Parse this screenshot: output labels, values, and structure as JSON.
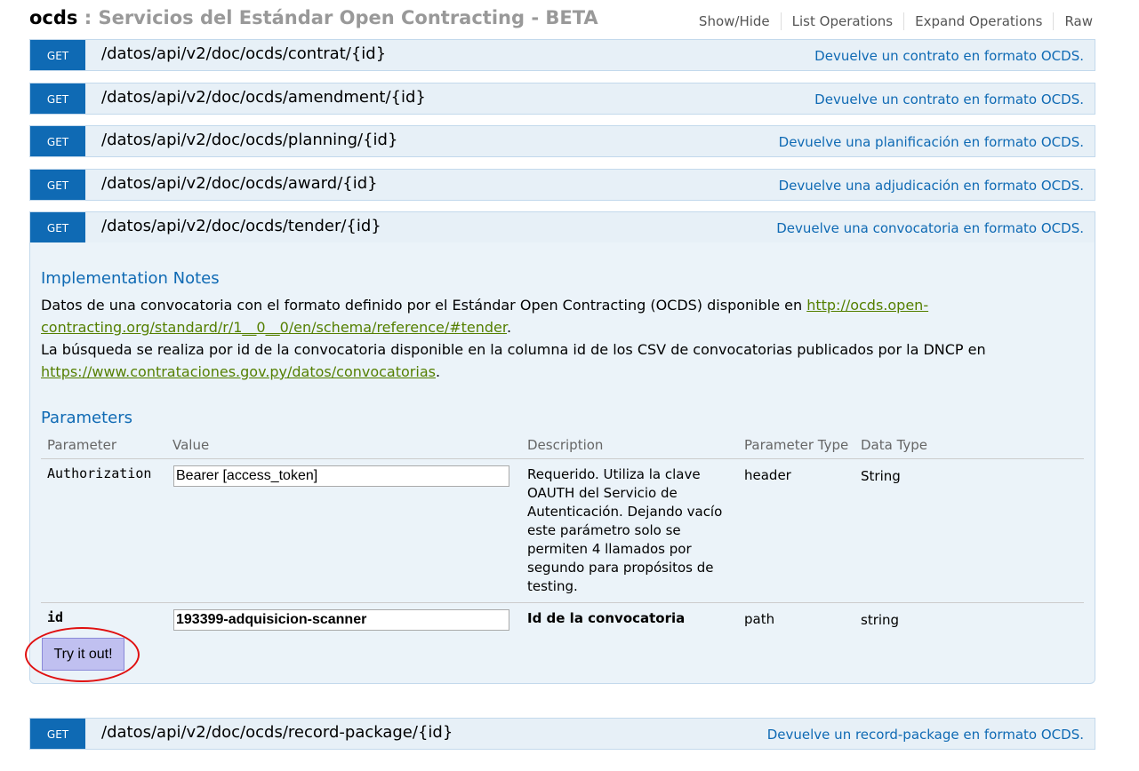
{
  "header": {
    "name": "ocds",
    "separator": " : ",
    "subtitle": "Servicios del Estándar Open Contracting - BETA",
    "links": [
      "Show/Hide",
      "List Operations",
      "Expand Operations",
      "Raw"
    ]
  },
  "operations": [
    {
      "method": "GET",
      "path": "/datos/api/v2/doc/ocds/contrat/{id}",
      "summary": "Devuelve un contrato en formato OCDS."
    },
    {
      "method": "GET",
      "path": "/datos/api/v2/doc/ocds/amendment/{id}",
      "summary": "Devuelve un contrato en formato OCDS."
    },
    {
      "method": "GET",
      "path": "/datos/api/v2/doc/ocds/planning/{id}",
      "summary": "Devuelve una planificación en formato OCDS."
    },
    {
      "method": "GET",
      "path": "/datos/api/v2/doc/ocds/award/{id}",
      "summary": "Devuelve una adjudicación en formato OCDS."
    },
    {
      "method": "GET",
      "path": "/datos/api/v2/doc/ocds/tender/{id}",
      "summary": "Devuelve una convocatoria en formato OCDS."
    },
    {
      "method": "GET",
      "path": "/datos/api/v2/doc/ocds/record-package/{id}",
      "summary": "Devuelve un record-package en formato OCDS."
    }
  ],
  "details": {
    "notes_title": "Implementation Notes",
    "notes": {
      "line1_text": "Datos de una convocatoria con el formato definido por el Estándar Open Contracting (OCDS) disponible en ",
      "line1_link": "http://ocds.open-",
      "line2_link": "contracting.org/standard/r/1__0__0/en/schema/reference/#tender",
      "line2_tail": ".",
      "line3_text": "La búsqueda se realiza por id de la convocatoria disponible en la columna id de los CSV de convocatorias publicados por la DNCP en",
      "line4_link": "https://www.contrataciones.gov.py/datos/convocatorias",
      "line4_tail": "."
    },
    "params_title": "Parameters",
    "columns": [
      "Parameter",
      "Value",
      "Description",
      "Parameter Type",
      "Data Type"
    ],
    "params": [
      {
        "name": "Authorization",
        "value": "Bearer [access_token]",
        "description_lines": [
          "Requerido. Utiliza la clave",
          "OAUTH del Servicio de",
          "Autenticación. Dejando vacío",
          "este parámetro solo se",
          "permiten 4 llamados por",
          "segundo para propósitos de",
          "testing."
        ],
        "param_type": "header",
        "data_type": "String"
      },
      {
        "name": "id",
        "value": "193399-adquisicion-scanner",
        "description": "Id de la convocatoria",
        "param_type": "path",
        "data_type": "string"
      }
    ],
    "try_button": "Try it out!"
  },
  "colors": {
    "get_method": "#0f6ab4",
    "op_background": "#e7f0f7",
    "link": "#547f00",
    "highlight": "#e01010"
  }
}
